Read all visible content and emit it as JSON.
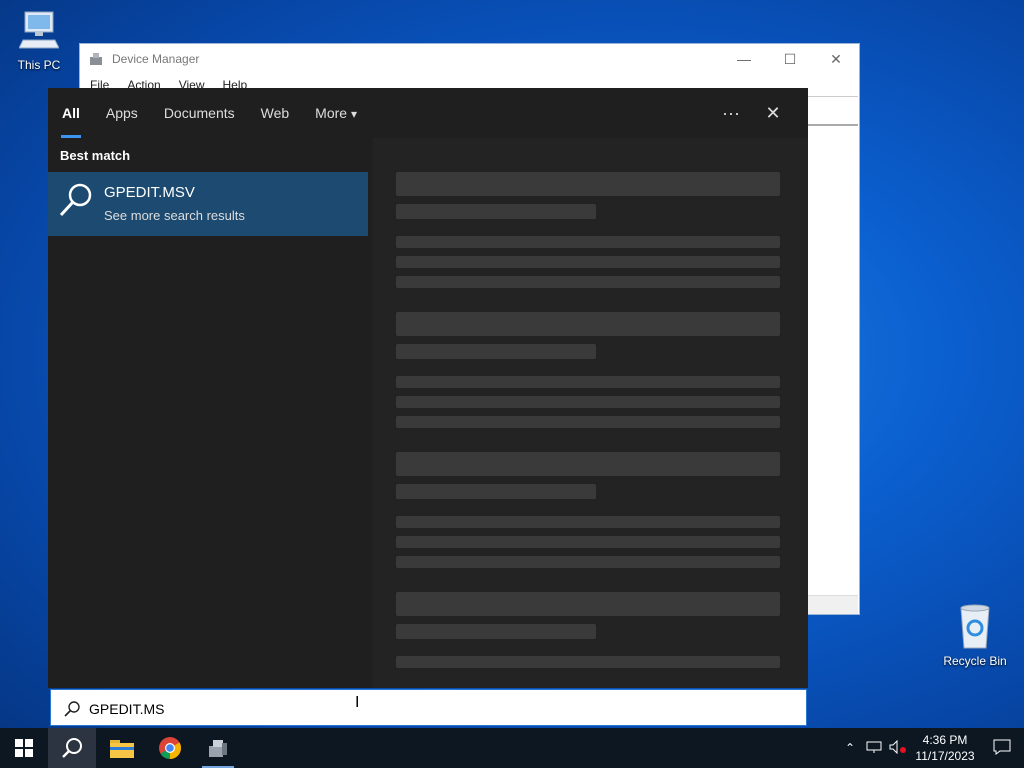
{
  "desktop": {
    "icons": [
      {
        "label": "This PC"
      },
      {
        "label": "Recycle Bin"
      }
    ]
  },
  "device_manager": {
    "title": "Device Manager",
    "menu": [
      "File",
      "Action",
      "View",
      "Help"
    ],
    "controls": {
      "minimize": "—",
      "maximize": "☐",
      "close": "✕"
    }
  },
  "search": {
    "tabs": [
      "All",
      "Apps",
      "Documents",
      "Web",
      "More"
    ],
    "more_arrow": "▾",
    "options_glyph": "···",
    "close_glyph": "✕",
    "best_match_label": "Best match",
    "best_match": {
      "title": "GPEDIT.MSV",
      "subtitle": "See more search results"
    },
    "query": "GPEDIT.MS",
    "accent": "#3c95f0"
  },
  "taskbar": {
    "clock_time": "4:36 PM",
    "clock_date": "11/17/2023",
    "tray_icons": [
      "chevron-up-icon",
      "network-icon",
      "volume-muted-icon",
      "notification-icon"
    ]
  }
}
